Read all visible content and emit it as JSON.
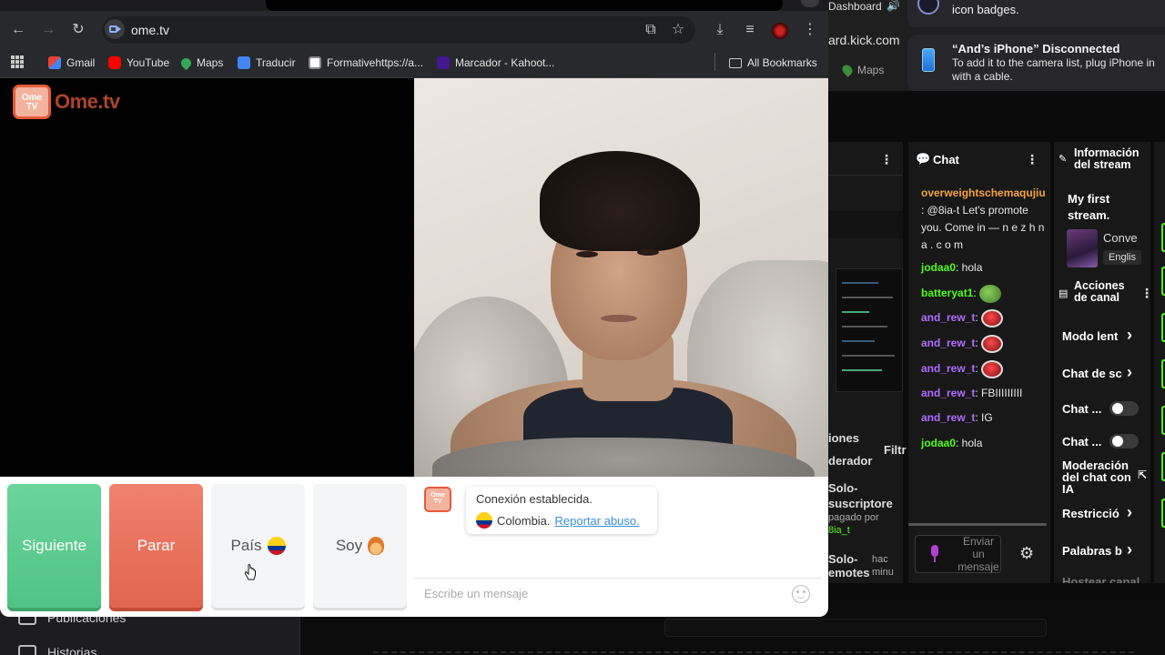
{
  "browser": {
    "url": "ome.tv",
    "bookmarks": [
      {
        "label": "Gmail",
        "icon": "gmail-icon"
      },
      {
        "label": "YouTube",
        "icon": "youtube-icon"
      },
      {
        "label": "Maps",
        "icon": "maps-icon"
      },
      {
        "label": "Traducir",
        "icon": "translate-icon"
      },
      {
        "label": "Formativehttps://a...",
        "icon": "formative-icon"
      },
      {
        "label": "Marcador - Kahoot...",
        "icon": "kahoot-icon"
      }
    ],
    "all_bookmarks": "All Bookmarks"
  },
  "ometv": {
    "logo_text": "Ome.tv",
    "logo_badge": "Ome TV",
    "buttons": {
      "next": "Siguiente",
      "stop": "Parar",
      "country": "País",
      "gender": "Soy"
    },
    "chat": {
      "status": "Conexión establecida.",
      "country": "Colombia.",
      "report": "Reportar abuso.",
      "placeholder": "Escribe un mensaje"
    }
  },
  "notification": {
    "top_text": "icon badges.",
    "title": "“And’s iPhone” Disconnected",
    "body": "To add it to the camera list, plug iPhone in with a cable."
  },
  "kick": {
    "top_label": "Dashboard",
    "url_fragment": "ard.kick.com",
    "maps": "Maps",
    "chat_title": "Chat",
    "chat_lines": [
      {
        "user": "overweightschemaqujiu",
        "text": ": @8ia-t Let's promote you. Come in — n e z h n a . c o m",
        "color": "orange"
      },
      {
        "user": "jodaa0",
        "text": ": hola",
        "color": "green"
      },
      {
        "user": "batteryat1",
        "text": ":",
        "color": "green"
      },
      {
        "user": "and_rew_t",
        "text": ":",
        "color": "purple"
      },
      {
        "user": "and_rew_t",
        "text": ":",
        "color": "purple"
      },
      {
        "user": "and_rew_t",
        "text": ":",
        "color": "purple"
      },
      {
        "user": "and_rew_t",
        "text": ": FBIIIIIIIII",
        "color": "purple"
      },
      {
        "user": "and_rew_t",
        "text": ": IG",
        "color": "purple"
      },
      {
        "user": "jodaa0",
        "text": ": hola",
        "color": "green"
      }
    ],
    "chat_send": "Enviar un mensaje",
    "info_title": "Información del stream",
    "stream_title": "My first stream.",
    "stream_category": "Conve",
    "stream_language": "Englis",
    "actions_title": "Acciones de canal",
    "actions": [
      "Modo lent",
      "Chat de sc",
      "Chat ...",
      "Chat ...",
      "Moderación del chat con IA",
      "Restricció",
      "Palabras b",
      "Hostear canal"
    ],
    "left_panel": {
      "section": "iones",
      "moderator": "derador",
      "filter": "Filtr",
      "solo_subs": "Solo-suscriptore",
      "off_by": "pagado por",
      "off_user": "8ia_t",
      "solo_emotes": "Solo-emotes",
      "ago": "hac minu"
    }
  },
  "background": {
    "left_items": [
      "Publicaciones",
      "Historias"
    ]
  }
}
